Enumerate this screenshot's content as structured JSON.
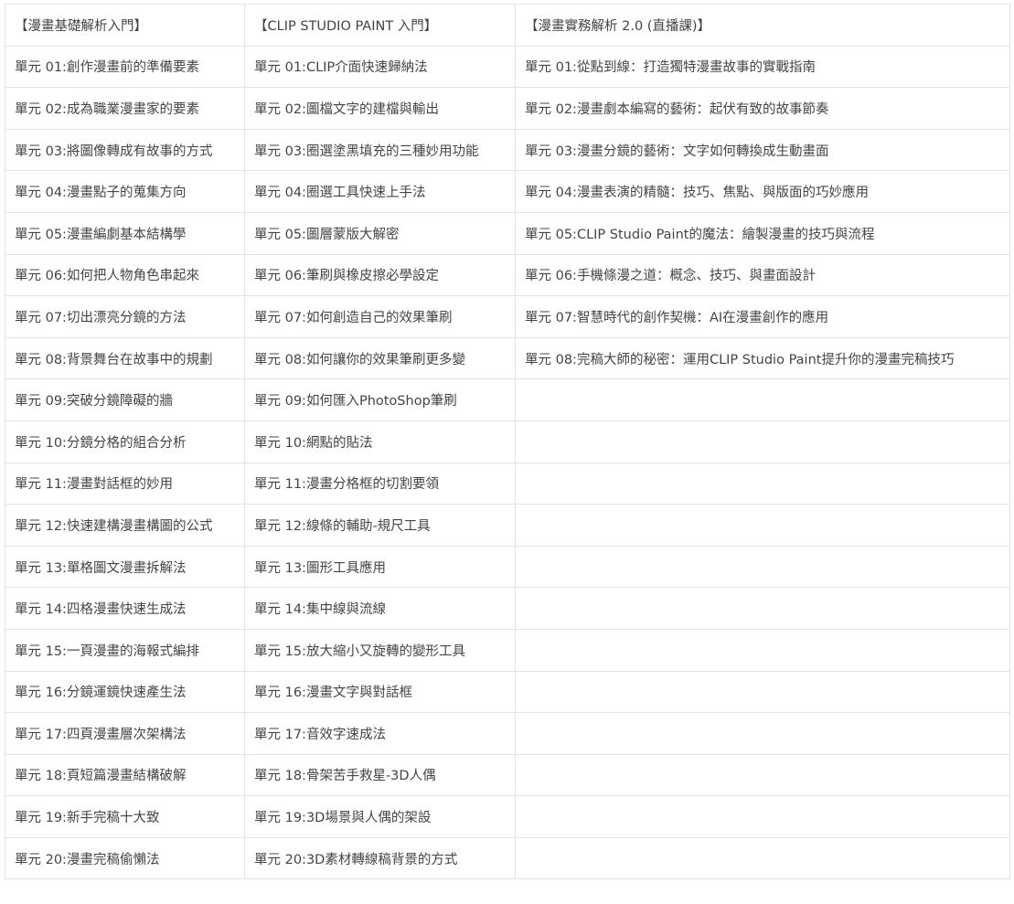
{
  "columns": [
    {
      "header": "【漫畫基礎解析入門】",
      "units": [
        "單元 01:創作漫畫前的準備要素",
        "單元 02:成為職業漫畫家的要素",
        "單元 03:將圖像轉成有故事的方式",
        "單元 04:漫畫點子的蒐集方向",
        "單元 05:漫畫編劇基本結構學",
        "單元 06:如何把人物角色串起來",
        "單元 07:切出漂亮分鏡的方法",
        "單元 08:背景舞台在故事中的規劃",
        "單元 09:突破分鏡障礙的牆",
        "單元 10:分鏡分格的組合分析",
        "單元 11:漫畫對話框的妙用",
        "單元 12:快速建構漫畫構圖的公式",
        "單元 13:單格圖文漫畫拆解法",
        "單元 14:四格漫畫快速生成法",
        "單元 15:一頁漫畫的海報式編排",
        "單元 16:分鏡運鏡快速產生法",
        "單元 17:四頁漫畫層次架構法",
        "單元 18:頁短篇漫畫結構破解",
        "單元 19:新手完稿十大致",
        "單元 20:漫畫完稿偷懶法"
      ]
    },
    {
      "header": "【CLIP STUDIO PAINT 入門】",
      "units": [
        "單元 01:CLIP介面快速歸納法",
        "單元 02:圖檔文字的建檔與輸出",
        "單元 03:圈選塗黑填充的三種妙用功能",
        "單元 04:圈選工具快速上手法",
        "單元 05:圖層蒙版大解密",
        "單元 06:筆刷與橡皮擦必學設定",
        "單元 07:如何創造自己的效果筆刷",
        "單元 08:如何讓你的效果筆刷更多變",
        "單元 09:如何匯入PhotoShop筆刷",
        "單元 10:網點的貼法",
        "單元 11:漫畫分格框的切割要領",
        "單元 12:線條的輔助-規尺工具",
        "單元 13:圖形工具應用",
        "單元 14:集中線與流線",
        "單元 15:放大縮小又旋轉的變形工具",
        "單元 16:漫畫文字與對話框",
        "單元 17:音效字速成法",
        "單元 18:骨架苦手救星-3D人偶",
        "單元 19:3D場景與人偶的架設",
        "單元 20:3D素材轉線稿背景的方式"
      ]
    },
    {
      "header": "【漫畫實務解析 2.0 (直播課)】",
      "units": [
        "單元 01:從點到線：打造獨特漫畫故事的實戰指南",
        "單元 02:漫畫劇本編寫的藝術：起伏有致的故事節奏",
        "單元 03:漫畫分鏡的藝術：文字如何轉換成生動畫面",
        "單元 04:漫畫表演的精髓：技巧、焦點、與版面的巧妙應用",
        "單元 05:CLIP Studio Paint的魔法：繪製漫畫的技巧與流程",
        "單元 06:手機條漫之道：概念、技巧、與畫面設計",
        "單元 07:智慧時代的創作契機：AI在漫畫創作的應用",
        "單元 08:完稿大師的秘密：運用CLIP Studio Paint提升你的漫畫完稿技巧"
      ]
    }
  ]
}
